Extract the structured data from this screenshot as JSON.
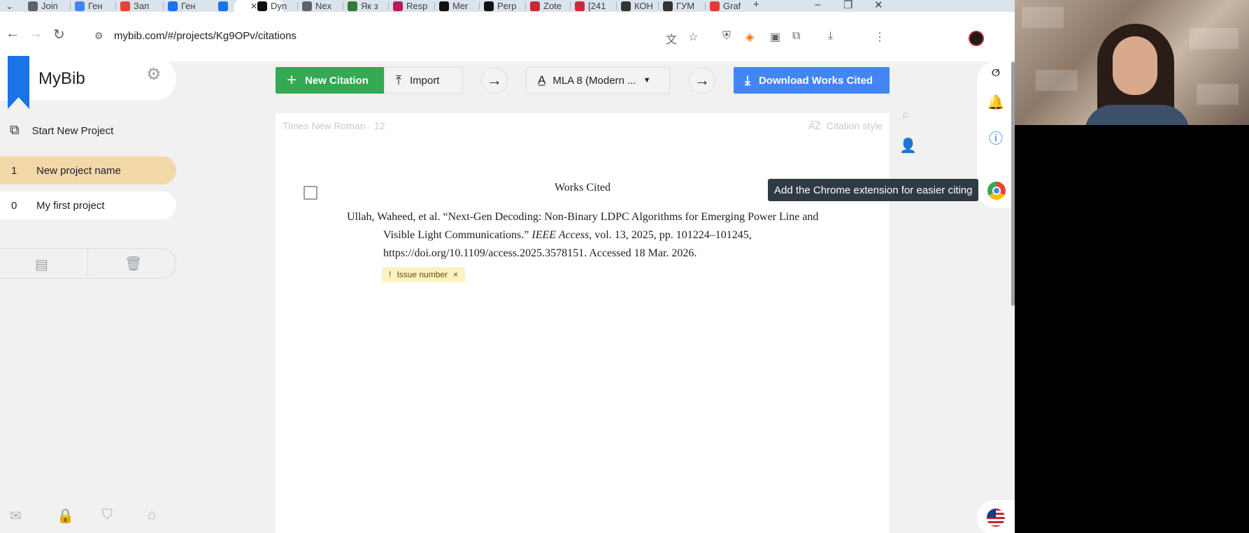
{
  "browser": {
    "tabs": [
      {
        "label": "Join",
        "icon": "globe-icon",
        "color": "#5f6368"
      },
      {
        "label": "Ген",
        "icon": "docs-icon",
        "color": "#4285f4"
      },
      {
        "label": "Зап",
        "icon": "gmail-icon",
        "color": "#ea4335"
      },
      {
        "label": "Ген",
        "icon": "u-icon",
        "color": "#1a73e8"
      },
      {
        "label": "",
        "icon": "mybib-icon",
        "color": "#1a73e8"
      },
      {
        "label": "Dyn",
        "icon": "dyn-icon",
        "color": "#111111"
      },
      {
        "label": "Nex",
        "icon": "globe-icon",
        "color": "#5f6368"
      },
      {
        "label": "Як з",
        "icon": "ei-icon",
        "color": "#2e7d32"
      },
      {
        "label": "Resp",
        "icon": "resp-icon",
        "color": "#b71c5a"
      },
      {
        "label": "Mer",
        "icon": "m-icon",
        "color": "#111111"
      },
      {
        "label": "Perp",
        "icon": "perplexity-icon",
        "color": "#111111"
      },
      {
        "label": "Zotе",
        "icon": "zotero-icon",
        "color": "#cc2936"
      },
      {
        "label": "[241",
        "icon": "x-icon",
        "color": "#cc2936"
      },
      {
        "label": "КОН",
        "icon": "pkp-icon",
        "color": "#333333"
      },
      {
        "label": "ГУМ",
        "icon": "gum-icon",
        "color": "#333333"
      },
      {
        "label": "Graf",
        "icon": "graf-icon",
        "color": "#e53935"
      }
    ],
    "url": "mybib.com/#/projects/Kg9OPv/citations"
  },
  "sidebar": {
    "logo": "MyBib",
    "start_new_project": "Start New Project",
    "projects": [
      {
        "count": "1",
        "name": "New project name",
        "selected": true
      },
      {
        "count": "0",
        "name": "My first project",
        "selected": false
      }
    ]
  },
  "actions": {
    "new_citation": "New Citation",
    "import": "Import",
    "citation_style": "MLA 8 (Modern ...",
    "download": "Download Works Cited"
  },
  "document": {
    "font_info": "Times New Roman · 12",
    "style_label": "Citation style",
    "title": "Works Cited",
    "citation": {
      "part1": "Ullah, Waheed, et al. “Next-Gen Decoding: Non-Binary LDPC Algorithms for Emerging Power Line and Visible Light Communications.” ",
      "journal": "IEEE Access",
      "part2": ", vol. 13, 2025, pp. 101224–101245, https://doi.org/10.1109/access.2025.3578151. Accessed 18 Mar. 2026."
    },
    "warning_badge": "Issue number",
    "warning_close": "×"
  },
  "rail": {
    "tooltip": "Add the Chrome extension for easier citing"
  },
  "colors": {
    "new_citation_bg": "#34a853",
    "download_bg": "#4285f4",
    "selected_project_bg": "#f3d8a8",
    "brand_blue": "#1a73e8"
  }
}
